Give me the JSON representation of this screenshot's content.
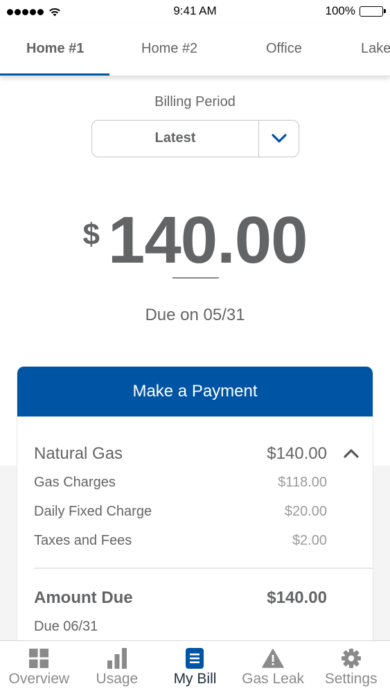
{
  "status_bar": {
    "signal_icon": "signal-dots-icon",
    "wifi_icon": "wifi-icon",
    "time": "9:41 AM",
    "battery_percent": "100%",
    "battery_icon": "battery-icon"
  },
  "location_tabs": [
    {
      "label": "Home #1",
      "active": true
    },
    {
      "label": "Home #2",
      "active": false
    },
    {
      "label": "Office",
      "active": false
    },
    {
      "label": "Lake",
      "active": false
    }
  ],
  "billing_period": {
    "label": "Billing Period",
    "selected": "Latest",
    "dropdown_icon": "chevron-down-icon"
  },
  "bill": {
    "currency_symbol": "$",
    "amount": "140.00",
    "due_text": "Due on 05/31"
  },
  "card": {
    "pay_button_label": "Make a Payment",
    "section": {
      "name": "Natural Gas",
      "total": "$140.00",
      "toggle_icon": "chevron-up-icon",
      "items": [
        {
          "label": "Gas Charges",
          "amount": "$118.00"
        },
        {
          "label": "Daily Fixed Charge",
          "amount": "$20.00"
        },
        {
          "label": "Taxes and Fees",
          "amount": "$2.00"
        }
      ]
    },
    "amount_due": {
      "label": "Amount Due",
      "amount": "$140.00",
      "due_date": "Due 06/31"
    }
  },
  "tab_bar": [
    {
      "label": "Overview",
      "icon": "grid-icon",
      "active": false
    },
    {
      "label": "Usage",
      "icon": "bar-chart-icon",
      "active": false
    },
    {
      "label": "My Bill",
      "icon": "bill-icon",
      "active": true
    },
    {
      "label": "Gas Leak",
      "icon": "warning-icon",
      "active": false
    },
    {
      "label": "Settings",
      "icon": "gear-icon",
      "active": false
    }
  ],
  "colors": {
    "brand_blue": "#0054a4",
    "text_gray": "#636466",
    "muted_gray": "#9a9a9a",
    "active_tab_text": "#222d3c",
    "background_gray": "#f4f4f4"
  }
}
